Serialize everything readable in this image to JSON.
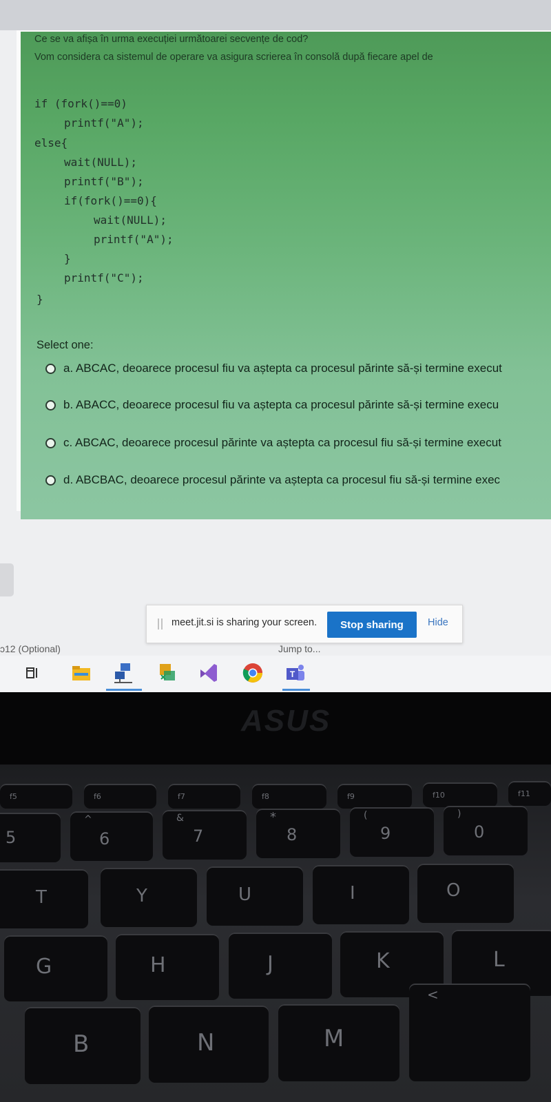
{
  "quiz": {
    "question_line_1": "Ce se va afișa în urma execuției următoarei secvențe de cod?",
    "question_line_2": "Vom considera ca sistemul de operare va asigura scrierea în consolă după fiecare apel de",
    "code_lines": [
      "if (fork()==0)",
      "printf(\"A\");",
      "else{",
      "wait(NULL);",
      "printf(\"B\");",
      "if(fork()==0){",
      "wait(NULL);",
      "printf(\"A\");",
      "}",
      "printf(\"C\");",
      "}"
    ],
    "select_label": "Select one:",
    "options": [
      "a. ABCAC, deoarece procesul fiu va aștepta ca procesul părinte să-și termine execut",
      "b. ABACC, deoarece procesul fiu va aștepta ca procesul părinte să-și termine execu",
      "c. ABCAC, deoarece procesul părinte va aștepta ca procesul fiu să-și termine execut",
      "d. ABCBAC, deoarece procesul părinte va aștepta ca procesul fiu să-și termine exec"
    ]
  },
  "share_bar": {
    "message": "meet.jit.si is sharing your screen.",
    "stop_label": "Stop sharing",
    "hide_label": "Hide"
  },
  "page_fragments": {
    "left": "ɔ12 (Optional)",
    "right": "Jump to..."
  },
  "taskbar": {
    "icons": [
      "task-view-icon",
      "file-explorer-icon",
      "network-app-icon",
      "code-editor-icon",
      "visual-studio-icon",
      "chrome-icon",
      "teams-icon"
    ]
  },
  "laptop": {
    "brand": "ASUS"
  },
  "keyboard": {
    "function_row": [
      "f5",
      "f6",
      "f7",
      "f8",
      "f9",
      "f10",
      "f11"
    ],
    "number_row": [
      {
        "main": "5",
        "shift": ""
      },
      {
        "main": "6",
        "shift": "^"
      },
      {
        "main": "7",
        "shift": "&"
      },
      {
        "main": "8",
        "shift": "*"
      },
      {
        "main": "9",
        "shift": "("
      },
      {
        "main": "0",
        "shift": ")"
      }
    ],
    "letter_row_1": [
      "T",
      "Y",
      "U",
      "I",
      "O"
    ],
    "letter_row_2": [
      "G",
      "H",
      "J",
      "K",
      "L"
    ],
    "letter_row_3": [
      "B",
      "N",
      "M",
      "<"
    ]
  },
  "colors": {
    "question_green": "#58a764",
    "stop_button_blue": "#1a73c8",
    "key_black": "#0c0c0e"
  }
}
